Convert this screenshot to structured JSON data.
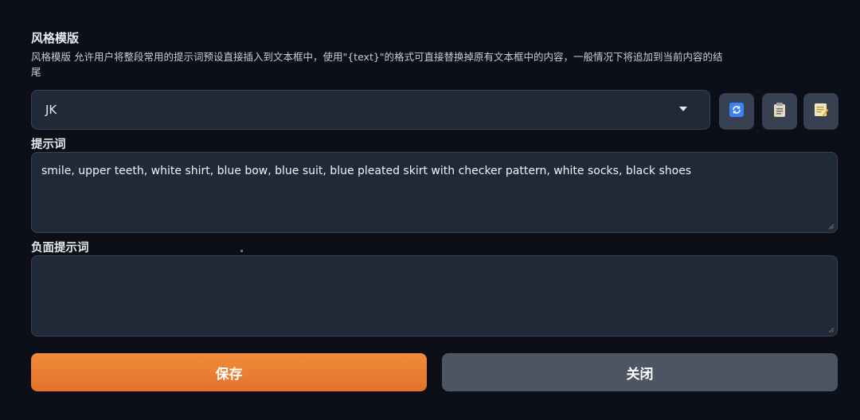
{
  "style_template": {
    "title": "风格模版",
    "description": "风格模版 允许用户将整段常用的提示词预设直接插入到文本框中，使用\"{text}\"的格式可直接替换掉原有文本框中的内容，一般情况下将追加到当前内容的结尾",
    "selected_value": "JK",
    "icons": [
      "refresh-icon",
      "clipboard-icon",
      "edit-note-icon"
    ]
  },
  "prompt": {
    "label": "提示词",
    "value": "smile, upper teeth, white shirt, blue bow, blue suit, blue pleated skirt with checker pattern, white socks, black shoes"
  },
  "negative_prompt": {
    "label": "负面提示词",
    "value": ""
  },
  "actions": {
    "save_label": "保存",
    "close_label": "关闭"
  },
  "colors": {
    "background": "#0c0f17",
    "input_bg": "#1f2937",
    "save_accent": "#e5722a",
    "close_bg": "#4b5563"
  }
}
